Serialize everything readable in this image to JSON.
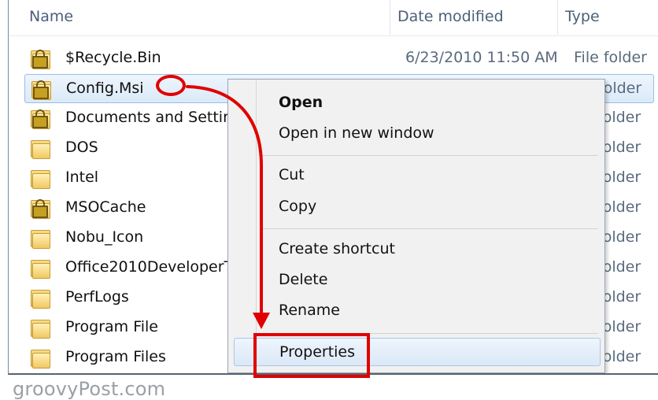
{
  "header": {
    "columns": [
      "Name",
      "Date modified",
      "Type"
    ]
  },
  "files": [
    {
      "name": "$Recycle.Bin",
      "date": "6/23/2010 11:50 AM",
      "type": "File folder",
      "locked": true,
      "selected": false
    },
    {
      "name": "Config.Msi",
      "date": "",
      "type": "folder",
      "locked": true,
      "selected": true
    },
    {
      "name": "Documents and Settir",
      "date": "",
      "type": "folder",
      "locked": true,
      "selected": false
    },
    {
      "name": "DOS",
      "date": "",
      "type": "folder",
      "locked": false,
      "selected": false
    },
    {
      "name": "Intel",
      "date": "",
      "type": "folder",
      "locked": false,
      "selected": false
    },
    {
      "name": "MSOCache",
      "date": "",
      "type": "folder",
      "locked": true,
      "selected": false
    },
    {
      "name": "Nobu_Icon",
      "date": "",
      "type": "folder",
      "locked": false,
      "selected": false
    },
    {
      "name": "Office2010DeveloperT",
      "date": "",
      "type": "folder",
      "locked": false,
      "selected": false
    },
    {
      "name": "PerfLogs",
      "date": "",
      "type": "folder",
      "locked": false,
      "selected": false
    },
    {
      "name": "Program File",
      "date": "",
      "type": "folder",
      "locked": false,
      "selected": false
    },
    {
      "name": "Program Files",
      "date": "",
      "type": "folder",
      "locked": false,
      "selected": false
    }
  ],
  "context_menu": {
    "items": [
      {
        "label": "Open",
        "bold": true
      },
      {
        "label": "Open in new window"
      },
      {
        "label": "Cut"
      },
      {
        "label": "Copy"
      },
      {
        "label": "Create shortcut"
      },
      {
        "label": "Delete"
      },
      {
        "label": "Rename"
      },
      {
        "label": "Properties",
        "highlighted": true
      }
    ]
  },
  "watermark": "groovyPost.com",
  "colors": {
    "annotation_red": "#e00000",
    "selection_blue": "#99bde6",
    "folder_yellow": "#f1c863"
  },
  "icons": {
    "folder": "folder-icon",
    "locked_folder": "locked-folder-icon"
  }
}
